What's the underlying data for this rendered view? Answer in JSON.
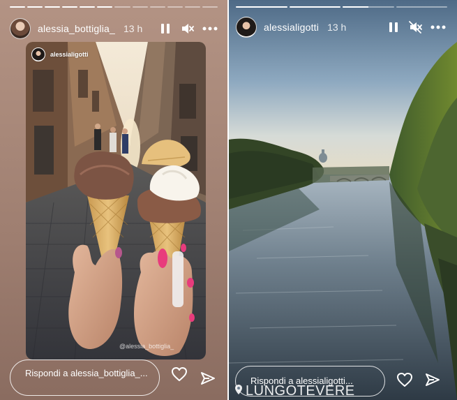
{
  "left_story": {
    "progress": [
      1,
      1,
      1,
      1,
      1,
      1,
      0,
      0,
      0,
      0,
      0,
      0
    ],
    "username": "alessia_bottiglia_",
    "time": "13 h",
    "reposted_from": "alessialigotti",
    "watermark": "@alessia_bottiglia_",
    "reply_placeholder": "Rispondi a alessia_bottiglia_..."
  },
  "right_story": {
    "progress": [
      1,
      1,
      0.5,
      0
    ],
    "username": "alessialigotti",
    "time": "13 h",
    "reply_placeholder": "Rispondi a alessialigotti...",
    "location_sticker": "LUNGOTEVERE"
  },
  "icons": {
    "pause": "pause-icon",
    "mute": "muted-speaker-icon",
    "more": "more-options-icon",
    "like": "heart-icon",
    "share": "send-icon",
    "location": "location-pin-icon"
  },
  "colors": {
    "story_bg": "#a9897a",
    "white": "#ffffff"
  }
}
